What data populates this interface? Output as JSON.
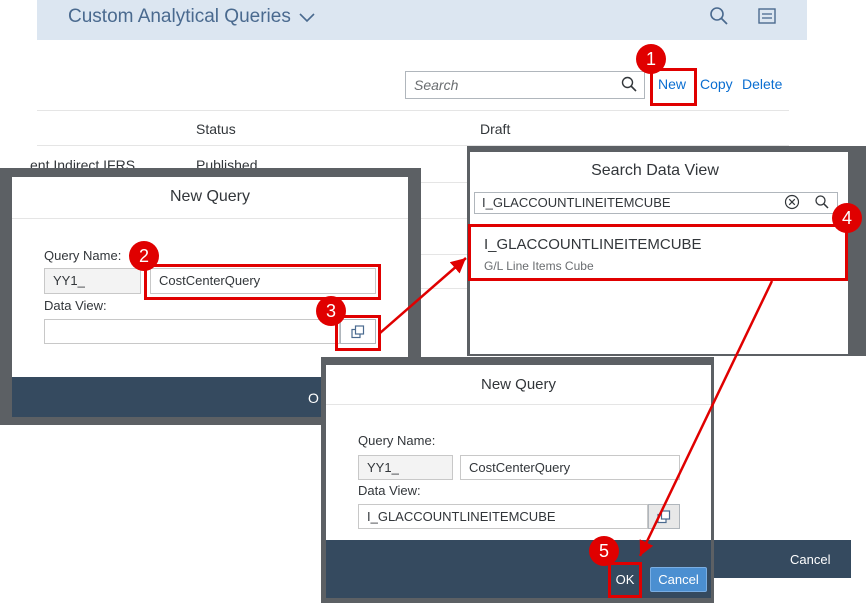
{
  "app": {
    "title": "Custom Analytical Queries"
  },
  "toolbar": {
    "search_placeholder": "Search",
    "new_label": "New",
    "copy_label": "Copy",
    "delete_label": "Delete"
  },
  "table": {
    "columns": [
      "Status",
      "Draft"
    ],
    "row_fragment_name": "ent Indirect IFRS",
    "row_fragment_status": "Published"
  },
  "dialog1": {
    "title": "New Query",
    "query_name_label": "Query Name:",
    "prefix": "YY1_",
    "query_name_value": "CostCenterQuery",
    "data_view_label": "Data View:",
    "data_view_value": "",
    "footer_fragment": "O"
  },
  "search_data_view": {
    "title": "Search Data View",
    "search_value": "I_GLACCOUNTLINEITEMCUBE",
    "result_title": "I_GLACCOUNTLINEITEMCUBE",
    "result_subtitle": "G/L Line Items Cube",
    "footer_cancel": "Cancel"
  },
  "dialog2": {
    "title": "New Query",
    "query_name_label": "Query Name:",
    "prefix": "YY1_",
    "query_name_value": "CostCenterQuery",
    "data_view_label": "Data View:",
    "data_view_value": "I_GLACCOUNTLINEITEMCUBE",
    "ok_label": "OK",
    "cancel_label": "Cancel"
  },
  "callouts": [
    "1",
    "2",
    "3",
    "4",
    "5"
  ],
  "colors": {
    "accent": "#0a6ed1",
    "callout": "#e00000",
    "footer": "#354a5f",
    "shellbar": "#dce6f1"
  },
  "icons": [
    "search-icon",
    "menu-icon",
    "chevron-down-icon",
    "value-help-icon",
    "clear-icon"
  ]
}
